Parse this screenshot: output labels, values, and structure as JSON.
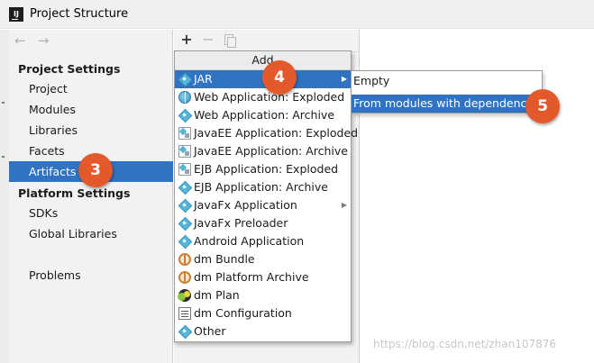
{
  "window": {
    "logo_text": "IJ",
    "title": "Project Structure"
  },
  "sidebar": {
    "nav_back": "←",
    "nav_forward": "→",
    "project_settings_header": "Project Settings",
    "project_settings_items": [
      "Project",
      "Modules",
      "Libraries",
      "Facets",
      "Artifacts"
    ],
    "selected_item": "Artifacts",
    "platform_settings_header": "Platform Settings",
    "platform_settings_items": [
      "SDKs",
      "Global Libraries"
    ],
    "problems": "Problems"
  },
  "toolbar": {
    "add": "+",
    "remove": "−"
  },
  "add_menu": {
    "header": "Add",
    "items": [
      {
        "label": "JAR",
        "icon": "diamond-icon",
        "has_submenu": true,
        "active": true
      },
      {
        "label": "Web Application: Exploded",
        "icon": "globe-icon"
      },
      {
        "label": "Web Application: Archive",
        "icon": "diamond-icon"
      },
      {
        "label": "JavaEE Application: Exploded",
        "icon": "box-icon"
      },
      {
        "label": "JavaEE Application: Archive",
        "icon": "box-icon"
      },
      {
        "label": "EJB Application: Exploded",
        "icon": "box-icon"
      },
      {
        "label": "EJB Application: Archive",
        "icon": "diamond-icon"
      },
      {
        "label": "JavaFx Application",
        "icon": "diamond-icon",
        "has_submenu": true
      },
      {
        "label": "JavaFx Preloader",
        "icon": "diamond-icon"
      },
      {
        "label": "Android Application",
        "icon": "diamond-icon"
      },
      {
        "label": "dm Bundle",
        "icon": "bundle-icon"
      },
      {
        "label": "dm Platform Archive",
        "icon": "bundle-icon"
      },
      {
        "label": "dm Plan",
        "icon": "plan-icon"
      },
      {
        "label": "dm Configuration",
        "icon": "config-icon"
      },
      {
        "label": "Other",
        "icon": "diamond-icon"
      }
    ]
  },
  "jar_submenu": {
    "items": [
      "Empty",
      "From modules with dependencies..."
    ],
    "active": "From modules with dependencies..."
  },
  "callouts": {
    "artifacts": "3",
    "jar": "4",
    "from_modules": "5"
  },
  "colors": {
    "selection": "#2f73c2",
    "callout": "#e3592b"
  },
  "watermark": "https://blog.csdn.net/zhan107876"
}
